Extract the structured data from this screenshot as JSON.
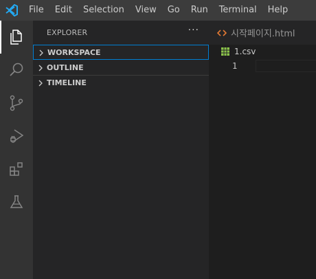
{
  "menu": [
    "File",
    "Edit",
    "Selection",
    "View",
    "Go",
    "Run",
    "Terminal",
    "Help"
  ],
  "activity_icons": [
    "explorer-icon",
    "search-icon",
    "source-control-icon",
    "run-debug-icon",
    "extensions-icon",
    "testing-icon"
  ],
  "sidebar": {
    "title": "EXPLORER",
    "more": "···",
    "sections": [
      "WORKSPACE",
      "OUTLINE",
      "TIMELINE"
    ]
  },
  "editor": {
    "tab_label": "시작페이지.html",
    "breadcrumb_file": "1.csv",
    "line_number": "1"
  },
  "colors": {
    "accent": "#007fd4",
    "vscode_blue": "#23a9f2",
    "html_icon": "#e37933",
    "csv_icon": "#8bc34a"
  }
}
